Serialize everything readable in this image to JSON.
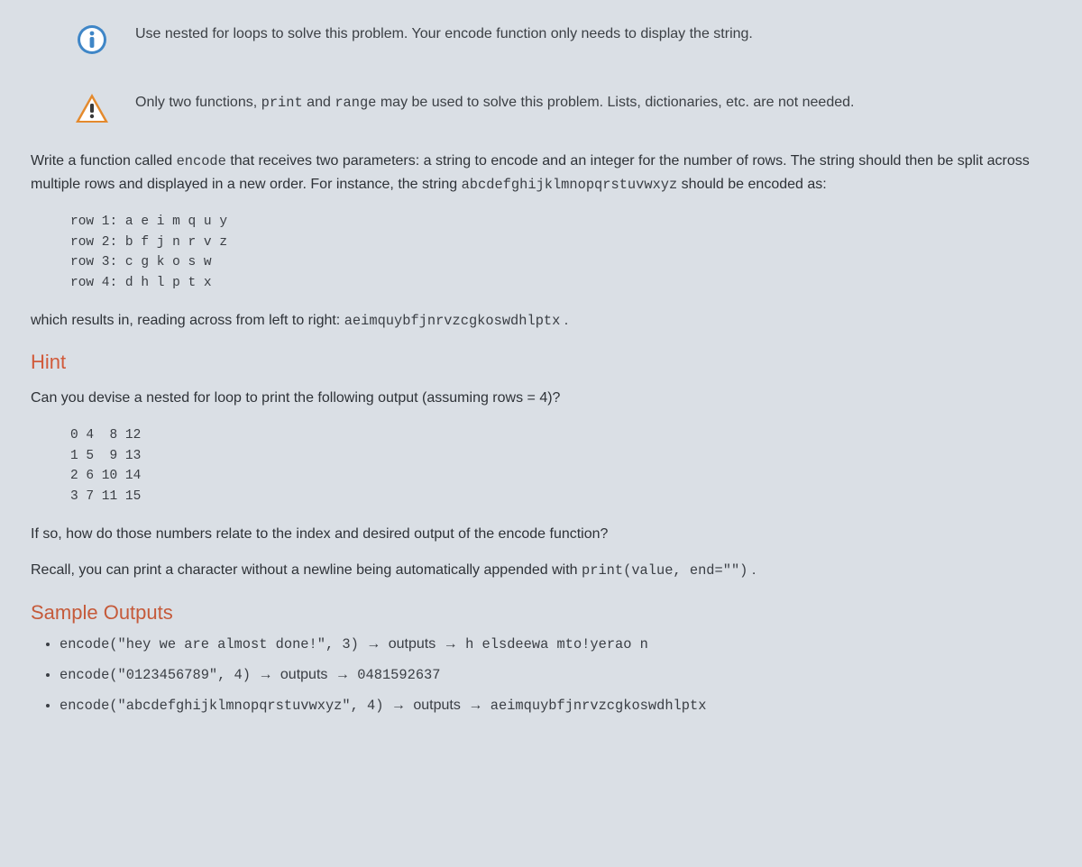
{
  "callouts": {
    "info": "Use nested for loops to solve this problem. Your encode function only needs to display the string.",
    "warn_pre": "Only two functions, ",
    "warn_code1": "print",
    "warn_mid": " and ",
    "warn_code2": "range",
    "warn_post": " may be used to solve this problem. Lists, dictionaries, etc. are not needed."
  },
  "intro": {
    "p1_pre": "Write a function called ",
    "p1_code": "encode",
    "p1_post": " that receives two parameters: a string to encode and an integer for the number of rows. The string should then be split across multiple rows and displayed in a new order. For instance, the string ",
    "p1_code2": "abcdefghijklmnopqrstuvwxyz",
    "p1_tail": " should be encoded as:"
  },
  "rows_block": "row 1: a e i m q u y\nrow 2: b f j n r v z\nrow 3: c g k o s w\nrow 4: d h l p t x",
  "result": {
    "pre": "which results in, reading across from left to right: ",
    "code": "aeimquybfjnrvzcgkoswdhlptx",
    "post": " ."
  },
  "hint": {
    "heading": "Hint",
    "q": "Can you devise a nested for loop to print the following output (assuming rows = 4)?",
    "grid": "0 4  8 12\n1 5  9 13\n2 6 10 14\n3 7 11 15",
    "p2": "If so, how do those numbers relate to the index and desired output of the encode function?",
    "p3_pre": "Recall, you can print a character without a newline being automatically appended with ",
    "p3_code": "print(value, end=\"\")",
    "p3_post": " ."
  },
  "samples": {
    "heading": "Sample Outputs",
    "items": [
      {
        "call": "encode(\"hey we are almost done!\", 3)",
        "out_label": "outputs",
        "out": "h  elsdeewa mto!yerao n"
      },
      {
        "call": "encode(\"0123456789\", 4)",
        "out_label": "outputs",
        "out": "0481592637"
      },
      {
        "call": "encode(\"abcdefghijklmnopqrstuvwxyz\", 4)",
        "out_label": "outputs",
        "out": "aeimquybfjnrvzcgkoswdhlptx"
      }
    ]
  },
  "glyphs": {
    "arrow": "→"
  }
}
